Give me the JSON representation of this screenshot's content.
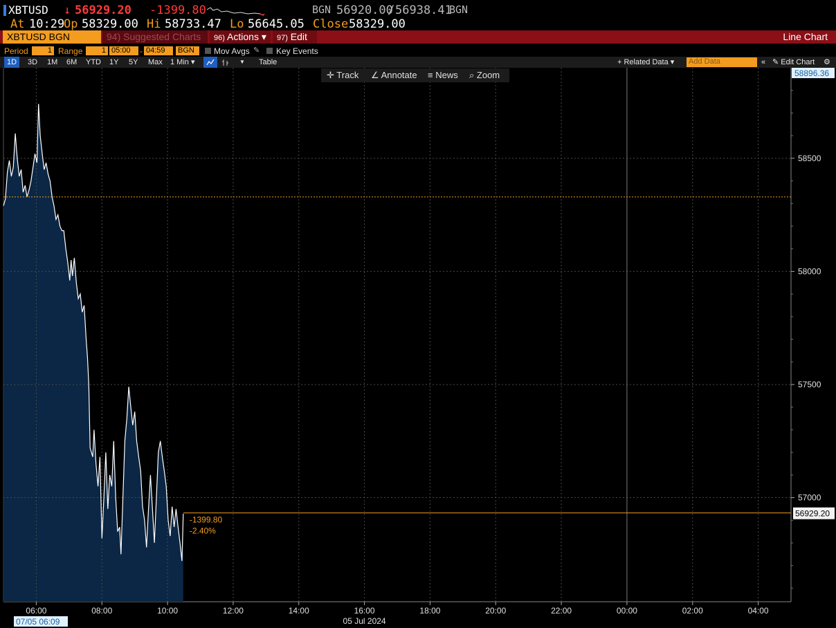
{
  "header": {
    "ticker": "XBTUSD",
    "arrow": "↓",
    "last": "56929.20",
    "change": "-1399.80",
    "source_label": "BGN",
    "bid": "56920.00",
    "ask": "56938.41",
    "source_label_2": "BGN",
    "at_label": "At",
    "at_value": "10:29",
    "op_label": "Op",
    "op_value": "58329.00",
    "hi_label": "Hi",
    "hi_value": "58733.47",
    "lo_label": "Lo",
    "lo_value": "56645.05",
    "close_label": "Close",
    "close_value": "58329.00"
  },
  "toolbar1": {
    "security": "XBTUSD BGN Curncy",
    "suggested": "94) Suggested Charts ▾",
    "actions_num": "96)",
    "actions": "Actions ▾",
    "edit_num": "97)",
    "edit": "Edit ▾",
    "chart_type": "Line Chart"
  },
  "toolbar2": {
    "period_label": "Period",
    "period_value": "1",
    "range_label": "Range",
    "range_value": "1",
    "range_start": "05:00",
    "range_sep": "-",
    "range_end": "04:59",
    "source": "BGN",
    "mov_avgs": "Mov Avgs",
    "key_events": "Key Events"
  },
  "toolbar3": {
    "ranges": [
      "1D",
      "3D",
      "1M",
      "6M",
      "YTD",
      "1Y",
      "5Y",
      "Max"
    ],
    "interval": "1 Min ▾",
    "table": "Table",
    "related": "+ Related Data ▾",
    "add_data_placeholder": "Add Data",
    "edit_chart": "Edit Chart"
  },
  "chart_tools": {
    "track": "Track",
    "annotate": "Annotate",
    "news": "News",
    "zoom": "Zoom"
  },
  "chart_data": {
    "type": "area",
    "x_ticks": [
      "06:00",
      "08:00",
      "10:00",
      "12:00",
      "14:00",
      "16:00",
      "18:00",
      "20:00",
      "22:00",
      "00:00",
      "02:00",
      "04:00"
    ],
    "x_date_label": "05 Jul 2024",
    "cursor_time": "07/05 06:09",
    "y_ticks": [
      57000,
      57500,
      58000,
      58500
    ],
    "y_top_label": "58896.36",
    "last_label": "56929.20",
    "change_label": "-1399.80",
    "change_pct_label": "-2.40%",
    "ylim": [
      56540,
      58900
    ],
    "x_start_hour": 5.0,
    "x_end_hour": 29.0,
    "prev_close": 58329.0,
    "last_price": 56929.2,
    "colors": {
      "line": "#ffffff",
      "fill": "#0b2745",
      "prev_close": "#f39c1f",
      "last": "#f39c1f",
      "grid": "#4a4a4a"
    },
    "series": [
      [
        5.0,
        58290
      ],
      [
        5.06,
        58320
      ],
      [
        5.12,
        58440
      ],
      [
        5.18,
        58490
      ],
      [
        5.24,
        58420
      ],
      [
        5.3,
        58460
      ],
      [
        5.36,
        58610
      ],
      [
        5.42,
        58500
      ],
      [
        5.48,
        58420
      ],
      [
        5.54,
        58450
      ],
      [
        5.6,
        58350
      ],
      [
        5.66,
        58380
      ],
      [
        5.72,
        58330
      ],
      [
        5.78,
        58360
      ],
      [
        5.84,
        58400
      ],
      [
        5.9,
        58460
      ],
      [
        5.96,
        58520
      ],
      [
        6.02,
        58480
      ],
      [
        6.07,
        58740
      ],
      [
        6.12,
        58600
      ],
      [
        6.18,
        58520
      ],
      [
        6.24,
        58450
      ],
      [
        6.3,
        58480
      ],
      [
        6.36,
        58430
      ],
      [
        6.42,
        58400
      ],
      [
        6.48,
        58330
      ],
      [
        6.54,
        58290
      ],
      [
        6.6,
        58230
      ],
      [
        6.66,
        58250
      ],
      [
        6.72,
        58200
      ],
      [
        6.78,
        58180
      ],
      [
        6.84,
        58180
      ],
      [
        6.9,
        58100
      ],
      [
        6.96,
        58040
      ],
      [
        7.02,
        57960
      ],
      [
        7.06,
        58050
      ],
      [
        7.1,
        57980
      ],
      [
        7.16,
        58060
      ],
      [
        7.22,
        57950
      ],
      [
        7.28,
        57880
      ],
      [
        7.34,
        57900
      ],
      [
        7.4,
        57820
      ],
      [
        7.46,
        57850
      ],
      [
        7.52,
        57700
      ],
      [
        7.56,
        57620
      ],
      [
        7.6,
        57500
      ],
      [
        7.64,
        57220
      ],
      [
        7.68,
        57200
      ],
      [
        7.72,
        57180
      ],
      [
        7.76,
        57300
      ],
      [
        7.82,
        57150
      ],
      [
        7.88,
        57050
      ],
      [
        7.94,
        57180
      ],
      [
        8.0,
        56820
      ],
      [
        8.06,
        57000
      ],
      [
        8.12,
        57200
      ],
      [
        8.18,
        56950
      ],
      [
        8.24,
        57100
      ],
      [
        8.3,
        57050
      ],
      [
        8.36,
        57250
      ],
      [
        8.42,
        57000
      ],
      [
        8.48,
        56850
      ],
      [
        8.54,
        56870
      ],
      [
        8.58,
        56750
      ],
      [
        8.64,
        57000
      ],
      [
        8.7,
        57250
      ],
      [
        8.76,
        57350
      ],
      [
        8.82,
        57490
      ],
      [
        8.88,
        57400
      ],
      [
        8.94,
        57320
      ],
      [
        9.0,
        57380
      ],
      [
        9.06,
        57250
      ],
      [
        9.12,
        57180
      ],
      [
        9.18,
        57120
      ],
      [
        9.24,
        56960
      ],
      [
        9.3,
        56900
      ],
      [
        9.36,
        56780
      ],
      [
        9.42,
        56950
      ],
      [
        9.48,
        57100
      ],
      [
        9.54,
        56950
      ],
      [
        9.6,
        56800
      ],
      [
        9.66,
        57000
      ],
      [
        9.72,
        57200
      ],
      [
        9.78,
        57250
      ],
      [
        9.84,
        57180
      ],
      [
        9.9,
        57120
      ],
      [
        9.96,
        57050
      ],
      [
        10.02,
        56900
      ],
      [
        10.08,
        56830
      ],
      [
        10.14,
        56960
      ],
      [
        10.2,
        56870
      ],
      [
        10.26,
        56950
      ],
      [
        10.32,
        56870
      ],
      [
        10.38,
        56800
      ],
      [
        10.44,
        56720
      ],
      [
        10.48,
        56929
      ]
    ]
  }
}
